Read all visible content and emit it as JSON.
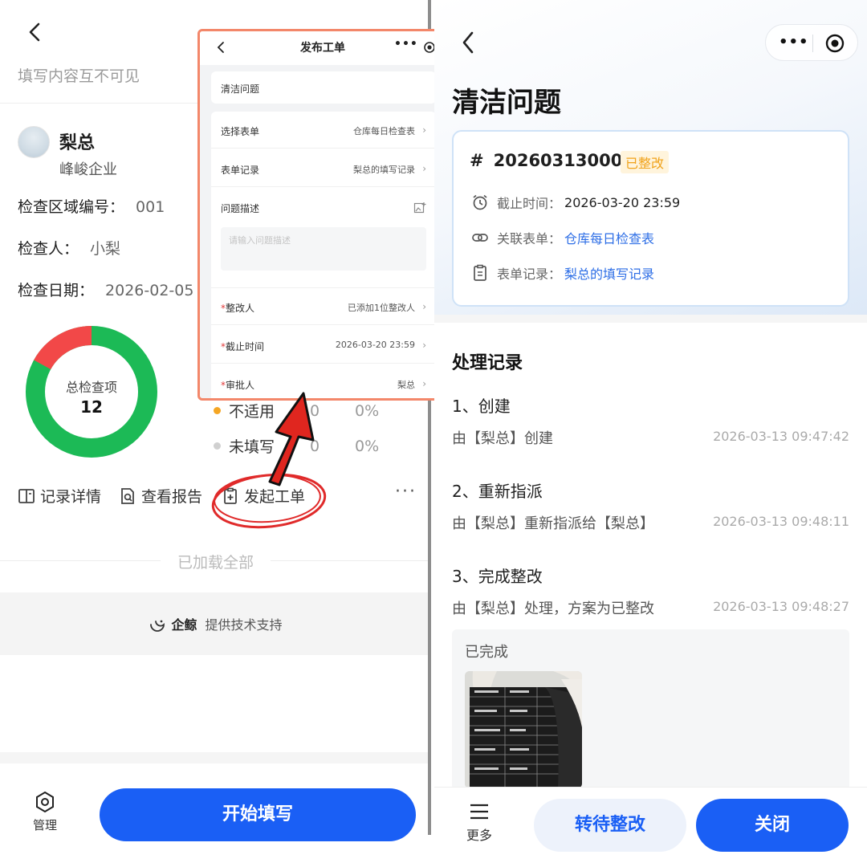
{
  "left": {
    "hint": "填写内容互不可见",
    "user": {
      "name": "梨总",
      "company": "峰峻企业"
    },
    "info": [
      {
        "label": "检查区域编号：",
        "value": "001"
      },
      {
        "label": "检查人：",
        "value": "小梨"
      },
      {
        "label": "检查日期：",
        "value": "2026-02-05"
      }
    ],
    "donut": {
      "center_label": "总检查项",
      "center_value": "12",
      "red_fraction": 0.17,
      "colors": {
        "green": "#1cba56",
        "red": "#f24848"
      }
    },
    "legend": [
      {
        "label": "不适用",
        "count": "0",
        "percent": "0%",
        "color": "#f5a623"
      },
      {
        "label": "未填写",
        "count": "0",
        "percent": "0%",
        "color": "#d0d0d0"
      }
    ],
    "actions": {
      "record_detail": "记录详情",
      "view_report": "查看报告",
      "start_ticket": "发起工单"
    },
    "loaded_all": "已加载全部",
    "support": {
      "brand": "企鲸",
      "text": "提供技术支持"
    },
    "bottom": {
      "manage": "管理",
      "start_fill": "开始填写"
    }
  },
  "popup": {
    "title": "发布工单",
    "issue_title": "清洁问题",
    "rows": [
      {
        "label": "选择表单",
        "value": "仓库每日检查表"
      },
      {
        "label": "表单记录",
        "value": "梨总的填写记录"
      }
    ],
    "desc_label": "问题描述",
    "desc_placeholder": "请输入问题描述",
    "rows2": [
      {
        "label": "整改人",
        "value": "已添加1位整改人"
      },
      {
        "label": "截止时间",
        "value": "2026-03-20 23:59"
      },
      {
        "label": "审批人",
        "value": "梨总"
      }
    ],
    "required_mark": "*"
  },
  "right": {
    "title": "清洁问题",
    "card": {
      "hash": "#",
      "number": "202603130001",
      "status": "已整改",
      "deadline_label": "截止时间：",
      "deadline": "2026-03-20 23:59",
      "form_label": "关联表单：",
      "form": "仓库每日检查表",
      "record_label": "表单记录：",
      "record": "梨总的填写记录"
    },
    "section_title": "处理记录",
    "steps": [
      {
        "title": "1、创建",
        "desc": "由【梨总】创建",
        "time": "2026-03-13 09:47:42"
      },
      {
        "title": "2、重新指派",
        "desc": "由【梨总】重新指派给【梨总】",
        "time": "2026-03-13 09:48:11"
      },
      {
        "title": "3、完成整改",
        "desc": "由【梨总】处理，方案为已整改",
        "time": "2026-03-13 09:48:27"
      }
    ],
    "done_label": "已完成",
    "bottom": {
      "more": "更多",
      "to_pending": "转待整改",
      "close": "关闭"
    }
  }
}
